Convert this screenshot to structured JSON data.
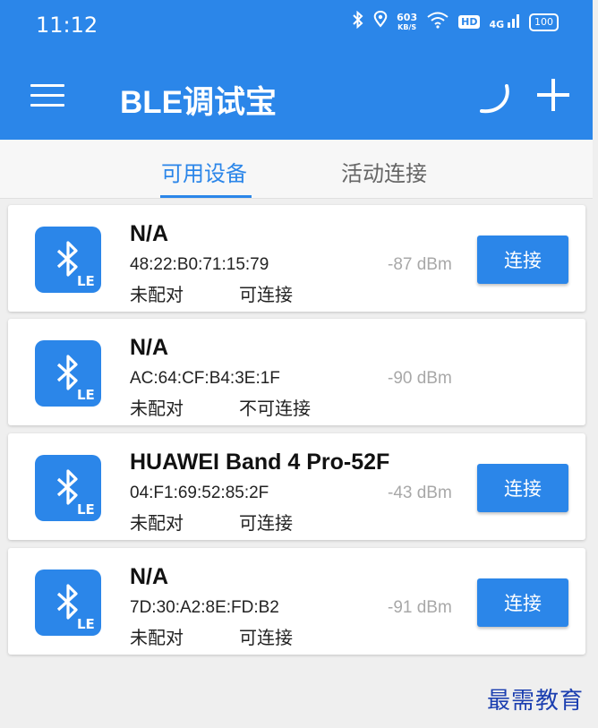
{
  "status_bar": {
    "time": "11:12",
    "net_speed_value": "603",
    "net_speed_unit": "KB/S",
    "hd_label": "HD",
    "signal_label": "4G",
    "battery": "100"
  },
  "app_bar": {
    "title": "BLE调试宝",
    "icons": [
      "menu-icon",
      "spinner-icon",
      "add-icon"
    ]
  },
  "tabs": [
    {
      "label": "可用设备",
      "active": true
    },
    {
      "label": "活动连接",
      "active": false
    }
  ],
  "devices": [
    {
      "name": "N/A",
      "mac": "48:22:B0:71:15:79",
      "rssi": "-87 dBm",
      "bond": "未配对",
      "connectable": "可连接",
      "button": "连接"
    },
    {
      "name": "N/A",
      "mac": "AC:64:CF:B4:3E:1F",
      "rssi": "-90 dBm",
      "bond": "未配对",
      "connectable": "不可连接",
      "button": null
    },
    {
      "name": "HUAWEI Band 4 Pro-52F",
      "mac": "04:F1:69:52:85:2F",
      "rssi": "-43 dBm",
      "bond": "未配对",
      "connectable": "可连接",
      "button": "连接"
    },
    {
      "name": "N/A",
      "mac": "7D:30:A2:8E:FD:B2",
      "rssi": "-91 dBm",
      "bond": "未配对",
      "connectable": "可连接",
      "button": "连接"
    }
  ],
  "ble_icon_badge": "LE",
  "watermark": "最需教育",
  "colors": {
    "primary": "#2b86e9",
    "background": "#efefef",
    "rssi_text": "#a8a8a8"
  }
}
